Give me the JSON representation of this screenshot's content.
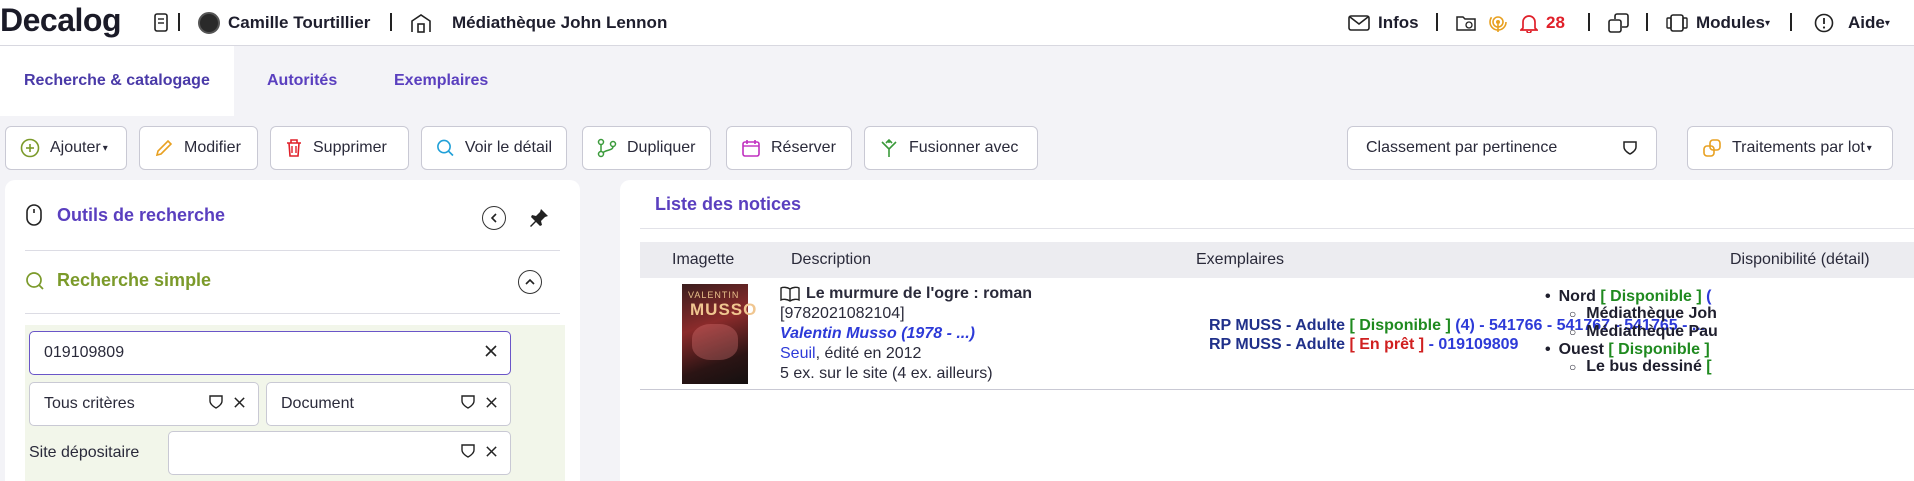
{
  "topbar": {
    "logo": "Decalog",
    "user": "Camille Tourtillier",
    "library": "Médiathèque John Lennon",
    "infos": "Infos",
    "notification_count": "28",
    "modules": "Modules",
    "aide": "Aide"
  },
  "tabs": [
    {
      "label": "Recherche & catalogage",
      "active": true
    },
    {
      "label": "Autorités",
      "active": false
    },
    {
      "label": "Exemplaires",
      "active": false
    }
  ],
  "toolbar": {
    "add": "Ajouter",
    "edit": "Modifier",
    "delete": "Supprimer",
    "detail": "Voir le détail",
    "duplicate": "Dupliquer",
    "reserve": "Réserver",
    "merge": "Fusionner avec",
    "sort": "Classement par pertinence",
    "batch": "Traitements par lot"
  },
  "left_panel": {
    "title": "Outils de recherche",
    "simple_search": "Recherche simple",
    "search_value": "019109809",
    "criteria": "Tous critères",
    "doc_type": "Document",
    "site_label": "Site dépositaire",
    "site_value": ""
  },
  "results": {
    "title": "Liste des notices",
    "columns": [
      "Imagette",
      "Description",
      "Exemplaires",
      "Disponibilité (détail)"
    ],
    "row": {
      "cover_text_author": "VALENTIN",
      "cover_text_name": "MUSSO",
      "title": "Le murmure de l'ogre : roman",
      "isbn": "[9782021082104]",
      "author": "Valentin Musso (1978 - ...)",
      "publisher": "Seuil",
      "edition": ", édité en 2012",
      "copies": "5 ex. sur le site (4 ex. ailleurs)",
      "ex_line1_cote": "RP MUSS - Adulte",
      "ex_line1_status": "[ Disponible ]",
      "ex_line1_codes": "(4) - 541766 - 541767 - 541765 - ...",
      "ex_line2_cote": "RP MUSS - Adulte",
      "ex_line2_status": "[ En prêt ]",
      "ex_line2_codes": "- 019109809",
      "dispo_nord": "Nord",
      "dispo_nord_status": "[ Disponible ]",
      "dispo_nord_extra": "(",
      "dispo_med1": "Médiathèque Joh",
      "dispo_med2": "Médiathèque Pau",
      "dispo_ouest": "Ouest",
      "dispo_ouest_status": "[ Disponible ]",
      "dispo_bus": "Le bus dessiné",
      "dispo_bus_status": "["
    }
  },
  "colors": {
    "accent": "#5a3fbf",
    "green": "#1f8a1f",
    "red": "#d02020",
    "link": "#2d3ad8"
  }
}
